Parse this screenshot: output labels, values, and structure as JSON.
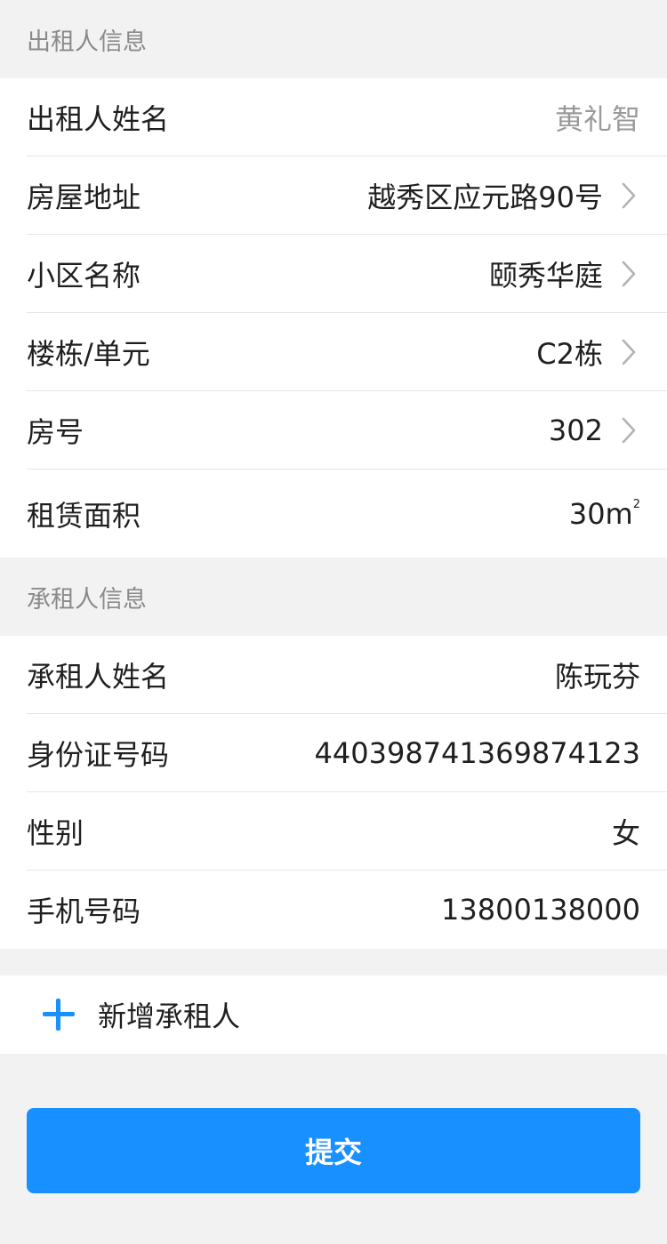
{
  "landlord": {
    "section_title": "出租人信息",
    "name_label": "出租人姓名",
    "name_value": "黄礼智",
    "address_label": "房屋地址",
    "address_value": "越秀区应元路90号",
    "community_label": "小区名称",
    "community_value": "颐秀华庭",
    "building_label": "楼栋/单元",
    "building_value": "C2栋",
    "room_label": "房号",
    "room_value": "302",
    "area_label": "租赁面积",
    "area_value": "30",
    "area_unit": "m",
    "area_unit_sup": "2"
  },
  "tenant": {
    "section_title": "承租人信息",
    "name_label": "承租人姓名",
    "name_value": "陈玩芬",
    "id_label": "身份证号码",
    "id_value": "440398741369874123",
    "gender_label": "性别",
    "gender_value": "女",
    "phone_label": "手机号码",
    "phone_value": "13800138000"
  },
  "actions": {
    "add_tenant_label": "新增承租人",
    "submit_label": "提交"
  },
  "colors": {
    "accent": "#1890ff",
    "background": "#f2f2f2",
    "muted_text": "#9a9a9a"
  },
  "icons": {
    "row_chevron": "chevron-right-icon",
    "add": "plus-icon"
  }
}
